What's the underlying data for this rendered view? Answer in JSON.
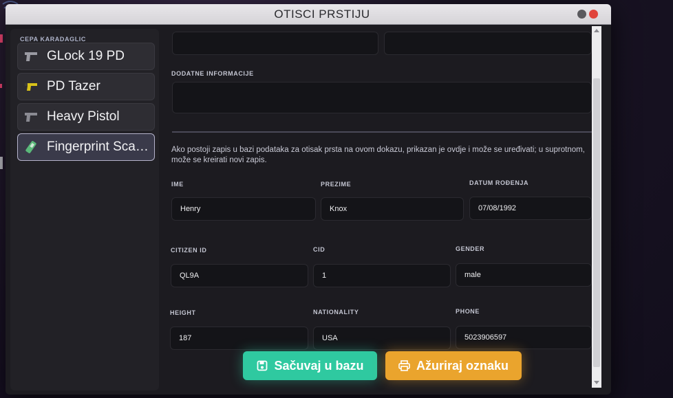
{
  "window": {
    "title": "OTISCI PRSTIJU"
  },
  "sidebar": {
    "heading": "CEPA KARADAGLIC",
    "items": [
      {
        "label": "GLock 19 PD",
        "icon": "pistol-icon"
      },
      {
        "label": "PD Tazer",
        "icon": "taser-icon"
      },
      {
        "label": "Heavy Pistol",
        "icon": "pistol-icon"
      },
      {
        "label": "Fingerprint Sca…",
        "icon": "fingerprint-scanner-icon",
        "active": true
      }
    ]
  },
  "form": {
    "top_field_1": "",
    "top_field_2": "",
    "additional_info_label": "DODATNE INFORMACIJE",
    "additional_info_value": "",
    "info_text": "Ako postoji zapis u bazi podataka za otisak prsta na ovom dokazu, prikazan je ovdje i može se uređivati; u suprotnom, može se kreirati novi zapis.",
    "fields": {
      "ime": {
        "label": "IME",
        "value": "Henry"
      },
      "prezime": {
        "label": "PREZIME",
        "value": "Knox"
      },
      "datum_rodenja": {
        "label": "DATUM ROĐENJA",
        "value": "07/08/1992"
      },
      "citizen_id": {
        "label": "CITIZEN ID",
        "value": "QL9A"
      },
      "cid": {
        "label": "CID",
        "value": "1"
      },
      "gender": {
        "label": "GENDER",
        "value": "male"
      },
      "height": {
        "label": "HEIGHT",
        "value": "187"
      },
      "nationality": {
        "label": "NATIONALITY",
        "value": "USA"
      },
      "phone": {
        "label": "PHONE",
        "value": "5023906597"
      }
    },
    "save_button": "Sačuvaj u bazu",
    "update_button": "Ažuriraj oznaku"
  },
  "colors": {
    "save_accent": "#2fc9a0",
    "update_accent": "#eaa42d",
    "close_button": "#e0443c"
  }
}
